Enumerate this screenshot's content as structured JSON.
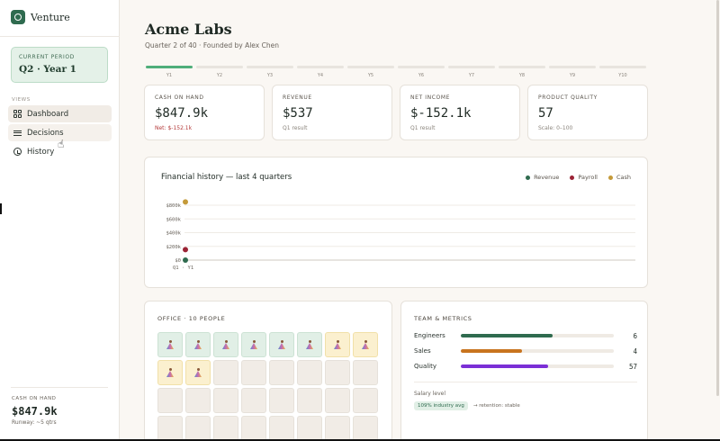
{
  "app": {
    "name": "Venture"
  },
  "sidebar": {
    "period": {
      "label": "Current period",
      "value": "Q2 · Year 1"
    },
    "views_label": "Views",
    "items": [
      {
        "label": "Dashboard",
        "icon": "grid-icon",
        "active": true
      },
      {
        "label": "Decisions",
        "icon": "list-icon",
        "active": false
      },
      {
        "label": "History",
        "icon": "clock-icon",
        "active": false
      }
    ],
    "cash": {
      "label": "Cash on hand",
      "value": "$847.9k",
      "runway": "Runway: ~5 qtrs"
    }
  },
  "header": {
    "title": "Acme Labs",
    "subtitle": "Quarter 2 of 40 · Founded by Alex Chen"
  },
  "timeline": {
    "labels": [
      "Y1",
      "Y2",
      "Y3",
      "Y4",
      "Y5",
      "Y6",
      "Y7",
      "Y8",
      "Y9",
      "Y10"
    ],
    "completed_fraction": 0.1
  },
  "stats": [
    {
      "label": "Cash on hand",
      "value": "$847.9k",
      "note": "Net: $-152.1k",
      "note_negative": true
    },
    {
      "label": "Revenue",
      "value": "$537",
      "note": "Q1 result",
      "note_negative": false
    },
    {
      "label": "Net income",
      "value": "$-152.1k",
      "note": "Q1 result",
      "note_negative": false
    },
    {
      "label": "Product quality",
      "value": "57",
      "note": "Scale: 0–100",
      "note_negative": false
    }
  ],
  "chart": {
    "title": "Financial history — last 4 quarters",
    "legend": [
      {
        "name": "Revenue",
        "color": "#2f6b4f"
      },
      {
        "name": "Payroll",
        "color": "#9b2335"
      },
      {
        "name": "Cash",
        "color": "#c49a3a"
      }
    ]
  },
  "chart_data": {
    "type": "scatter",
    "title": "Financial history — last 4 quarters",
    "x": [
      "Q1 · Y1"
    ],
    "y_ticks": [
      "$0",
      "$200k",
      "$400k",
      "$600k",
      "$800k"
    ],
    "ylim": [
      0,
      800
    ],
    "y_unit": "$k",
    "series": [
      {
        "name": "Revenue",
        "values": [
          0.5
        ],
        "color": "#2f6b4f"
      },
      {
        "name": "Payroll",
        "values": [
          152
        ],
        "color": "#9b2335"
      },
      {
        "name": "Cash",
        "values": [
          848
        ],
        "color": "#c49a3a"
      }
    ],
    "grid": true,
    "legend_position": "top-right"
  },
  "office": {
    "title": "Office · 10 people",
    "engineers": 6,
    "sales": 4,
    "total_desks_visible": 32
  },
  "team": {
    "title": "Team & metrics",
    "metrics": [
      {
        "name": "Engineers",
        "value": "6",
        "fraction": 0.6,
        "color": "#2f6b4f"
      },
      {
        "name": "Sales",
        "value": "4",
        "fraction": 0.4,
        "color": "#c8741e"
      },
      {
        "name": "Quality",
        "value": "57",
        "fraction": 0.57,
        "color": "#7b2fd6"
      }
    ],
    "salary_label": "Salary level",
    "salary_badge": "109% industry avg",
    "salary_note": "→ retention: stable"
  }
}
